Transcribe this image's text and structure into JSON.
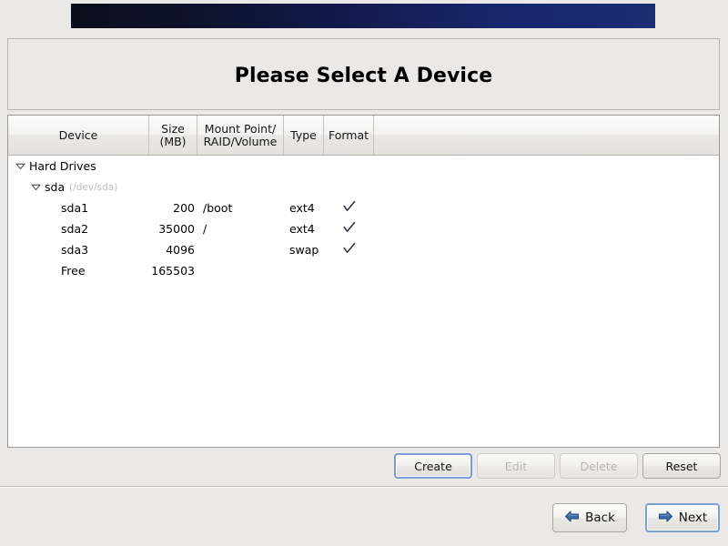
{
  "window": {
    "title": "Please Select A Device",
    "banner_gradient_from": "#090e1d",
    "banner_gradient_to": "#1b2d73",
    "background_color": "#ebe9e7"
  },
  "table": {
    "columns": [
      {
        "key": "device",
        "label": "Device"
      },
      {
        "key": "size",
        "label": "Size\n(MB)",
        "label_line1": "Size",
        "label_line2": "(MB)"
      },
      {
        "key": "mount",
        "label": "Mount Point/\nRAID/Volume",
        "label_line1": "Mount Point/",
        "label_line2": "RAID/Volume"
      },
      {
        "key": "type",
        "label": "Type"
      },
      {
        "key": "format",
        "label": "Format"
      }
    ],
    "rows": [
      {
        "kind": "group",
        "indent": 0,
        "expander": "expanded",
        "device": "Hard Drives",
        "device_path": "",
        "size": "",
        "mount": "",
        "type": "",
        "format": false
      },
      {
        "kind": "disk",
        "indent": 1,
        "expander": "expanded",
        "device": "sda",
        "device_path": "(/dev/sda)",
        "size": "",
        "mount": "",
        "type": "",
        "format": false
      },
      {
        "kind": "partition",
        "indent": 2,
        "expander": "none",
        "device": "sda1",
        "device_path": "",
        "size": "200",
        "mount": "/boot",
        "type": "ext4",
        "format": true
      },
      {
        "kind": "partition",
        "indent": 2,
        "expander": "none",
        "device": "sda2",
        "device_path": "",
        "size": "35000",
        "mount": "/",
        "type": "ext4",
        "format": true
      },
      {
        "kind": "partition",
        "indent": 2,
        "expander": "none",
        "device": "sda3",
        "device_path": "",
        "size": "4096",
        "mount": "",
        "type": "swap",
        "format": true
      },
      {
        "kind": "free",
        "indent": 2,
        "expander": "none",
        "device": "Free",
        "device_path": "",
        "size": "165503",
        "mount": "",
        "type": "",
        "format": false
      }
    ]
  },
  "actions": {
    "create_label": "Create",
    "edit_label": "Edit",
    "delete_label": "Delete",
    "reset_label": "Reset"
  },
  "navigation": {
    "back_label": "Back",
    "next_label": "Next",
    "back_icon": "arrow-left-icon",
    "next_icon": "arrow-right-icon",
    "arrow_color": "#3b6ea8"
  }
}
